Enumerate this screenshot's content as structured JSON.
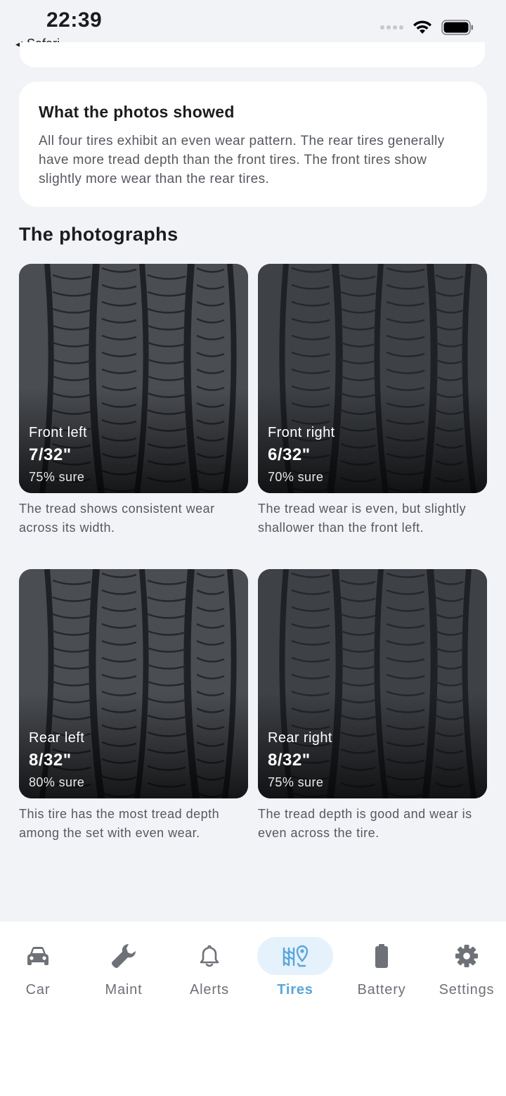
{
  "status_bar": {
    "time": "22:39",
    "back_app": "Safari"
  },
  "summary": {
    "title": "What the photos showed",
    "text": "All four tires exhibit an even wear pattern. The rear tires generally have more tread depth than the front tires. The front tires show slightly more wear than the rear tires."
  },
  "photos_section": {
    "title": "The photographs",
    "tiles": [
      {
        "position": "Front left",
        "depth": "7/32\"",
        "confidence": "75% sure",
        "caption": "The tread shows consistent wear across its width."
      },
      {
        "position": "Front right",
        "depth": "6/32\"",
        "confidence": "70% sure",
        "caption": "The tread wear is even, but slightly shallower than the front left."
      },
      {
        "position": "Rear left",
        "depth": "8/32\"",
        "confidence": "80% sure",
        "caption": "This tire has the most tread depth among the set with even wear."
      },
      {
        "position": "Rear right",
        "depth": "8/32\"",
        "confidence": "75% sure",
        "caption": "The tread depth is good and wear is even across the tire."
      }
    ]
  },
  "tab_bar": {
    "active": "Tires",
    "accent_color": "#58a6dd",
    "tabs": [
      {
        "label": "Car",
        "icon": "car-icon"
      },
      {
        "label": "Maint",
        "icon": "wrench-icon"
      },
      {
        "label": "Alerts",
        "icon": "bell-icon"
      },
      {
        "label": "Tires",
        "icon": "tire-icon"
      },
      {
        "label": "Battery",
        "icon": "battery-icon"
      },
      {
        "label": "Settings",
        "icon": "gear-icon"
      }
    ]
  }
}
